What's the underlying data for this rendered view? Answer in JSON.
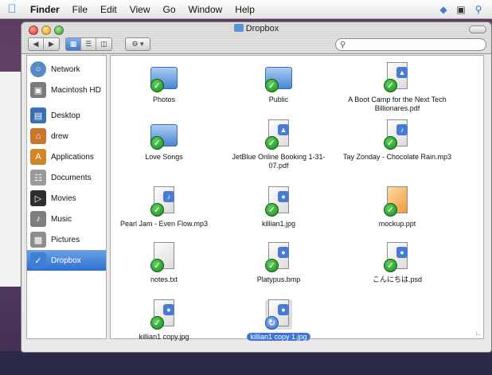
{
  "menubar": {
    "app": "Finder",
    "items": [
      "File",
      "Edit",
      "View",
      "Go",
      "Window",
      "Help"
    ]
  },
  "window": {
    "title": "Dropbox"
  },
  "search": {
    "placeholder": ""
  },
  "sidebar": {
    "items": [
      {
        "label": "Network",
        "icon": "network-globe-icon",
        "color": "#5a8ac6"
      },
      {
        "label": "Macintosh HD",
        "icon": "hard-drive-icon",
        "color": "#7b7b7b"
      },
      {
        "label": "Desktop",
        "icon": "desktop-icon",
        "color": "#3b6fb5"
      },
      {
        "label": "drew",
        "icon": "home-icon",
        "color": "#c9772b"
      },
      {
        "label": "Applications",
        "icon": "applications-icon",
        "color": "#d1862b"
      },
      {
        "label": "Documents",
        "icon": "documents-icon",
        "color": "#9a9a9a"
      },
      {
        "label": "Movies",
        "icon": "movies-icon",
        "color": "#2e2e2e"
      },
      {
        "label": "Music",
        "icon": "music-icon",
        "color": "#7f7f7f"
      },
      {
        "label": "Pictures",
        "icon": "pictures-icon",
        "color": "#8d8d8d"
      },
      {
        "label": "Dropbox",
        "icon": "dropbox-folder-icon",
        "color": "#3e7fd6"
      }
    ]
  },
  "files": [
    {
      "name": "Photos",
      "type": "folder"
    },
    {
      "name": "Public",
      "type": "folder"
    },
    {
      "name": "A Boot Camp for the Next Tech Billionares.pdf",
      "type": "doc"
    },
    {
      "name": "Love Songs",
      "type": "folder"
    },
    {
      "name": "JetBlue Online Booking 1-31-07.pdf",
      "type": "doc"
    },
    {
      "name": "Tay Zonday - Chocolate Rain.mp3",
      "type": "doc"
    },
    {
      "name": "Pearl Jam - Even Flow.mp3",
      "type": "doc"
    },
    {
      "name": "killian1.jpg",
      "type": "doc"
    },
    {
      "name": "mockup.ppt",
      "type": "doc"
    },
    {
      "name": "notes.txt",
      "type": "doc"
    },
    {
      "name": "Platypus.bmp",
      "type": "doc"
    },
    {
      "name": "こんにちは.psd",
      "type": "doc"
    },
    {
      "name": "killian1 copy.jpg",
      "type": "doc"
    },
    {
      "name": "killian1 copy 1.jpg",
      "type": "doc",
      "selected": true
    }
  ],
  "colors": {
    "selection": "#3d74d6",
    "sync_check": "#1c8a1c"
  }
}
